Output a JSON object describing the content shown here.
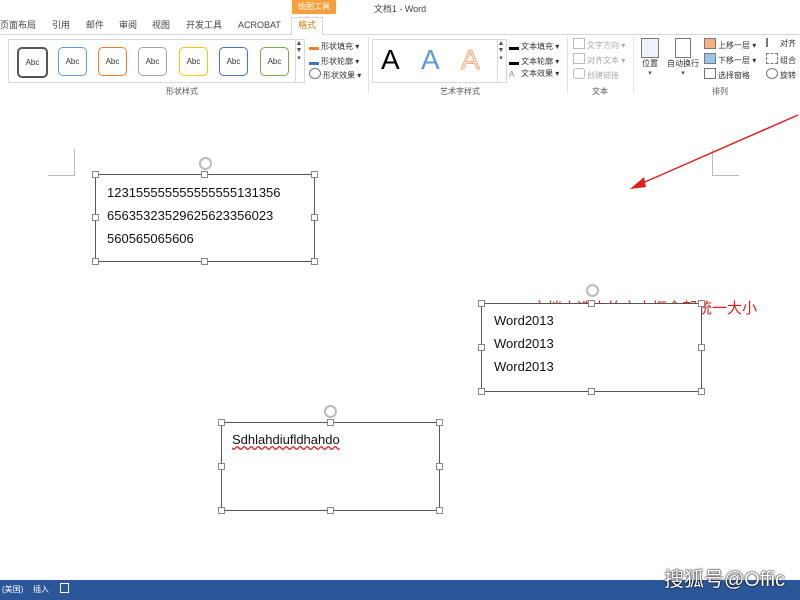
{
  "window": {
    "title": "文档1 - Word",
    "contextual_tab_group": "绘图工具"
  },
  "tabs": [
    {
      "label": "页面布局"
    },
    {
      "label": "引用"
    },
    {
      "label": "邮件"
    },
    {
      "label": "审阅"
    },
    {
      "label": "视图"
    },
    {
      "label": "开发工具"
    },
    {
      "label": "ACROBAT"
    },
    {
      "label": "格式",
      "active": true
    }
  ],
  "ribbon": {
    "shape_styles": {
      "group_label": "形状样式",
      "gallery": [
        {
          "label": "Abc",
          "color": "#555555"
        },
        {
          "label": "Abc",
          "color": "#5b9bd5"
        },
        {
          "label": "Abc",
          "color": "#ed7d31"
        },
        {
          "label": "Abc",
          "color": "#a5a5a5"
        },
        {
          "label": "Abc",
          "color": "#ffc000"
        },
        {
          "label": "Abc",
          "color": "#4472c4"
        },
        {
          "label": "Abc",
          "color": "#70ad47"
        }
      ],
      "fill_label": "形状填充",
      "outline_label": "形状轮廓",
      "effects_label": "形状效果"
    },
    "wordart_styles": {
      "group_label": "艺术字样式",
      "gallery": [
        {
          "label": "A",
          "color": "#000000"
        },
        {
          "label": "A",
          "color": "#5b9bd5"
        },
        {
          "label": "A",
          "color": "#f4b183"
        }
      ],
      "text_fill_label": "文本填充",
      "text_outline_label": "文本轮廓",
      "text_effects_label": "文本效果"
    },
    "text": {
      "group_label": "文本",
      "direction_label": "文字方向",
      "align_label": "对齐文本",
      "link_label": "创建链接"
    },
    "arrange": {
      "group_label": "排列",
      "position_label": "位置",
      "wrap_label": "自动换行",
      "bring_forward_label": "上移一层",
      "send_backward_label": "下移一层",
      "selection_pane_label": "选择窗格",
      "align_label": "对齐",
      "group_btn_label": "组合",
      "rotate_label": "旋转"
    }
  },
  "document": {
    "textbox1": {
      "lines": [
        "123155555555555555131356",
        "656353235296256233560​23",
        "560565065606"
      ]
    },
    "textbox2": {
      "lines": [
        "Word2013",
        "Word2013",
        "Word2013"
      ]
    },
    "textbox3": {
      "lines": [
        "Sdhlahdiufldhahdo"
      ]
    },
    "annotation": "文档中选中的文本框全部统一大小",
    "annotation_color": "#e02020"
  },
  "watermark": "搜狐号@Offic",
  "statusbar": {
    "language": "(美国)",
    "mode": "插入"
  },
  "colors": {
    "accent_tab": "#d47d12",
    "contextual_group_bg": "#f4a03c",
    "statusbar_bg": "#2b579a"
  }
}
